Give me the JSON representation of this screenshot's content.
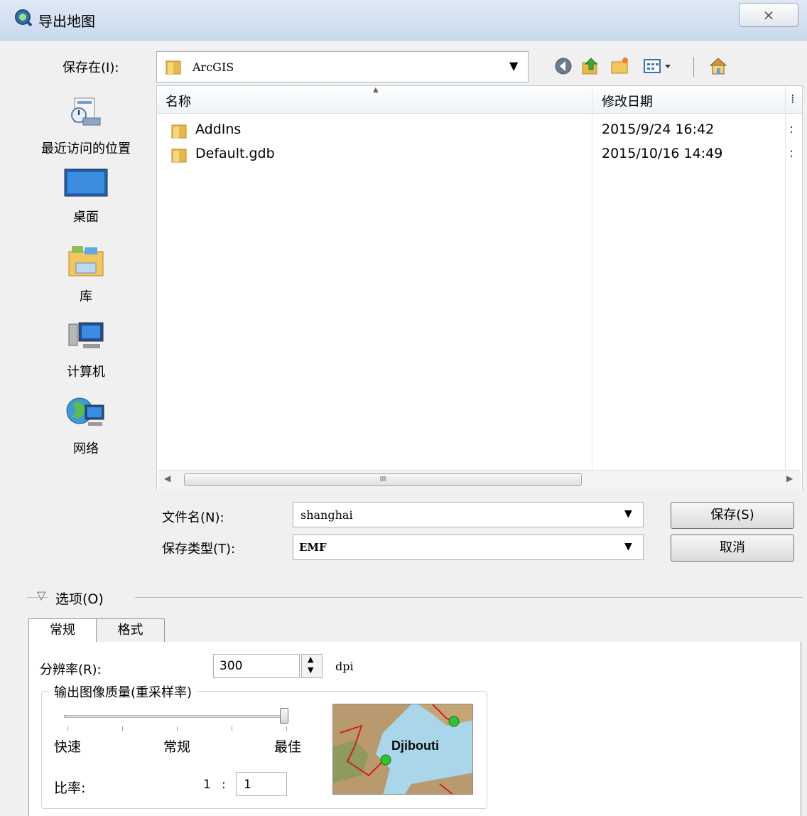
{
  "window": {
    "title": "导出地图",
    "close_label": "⨯"
  },
  "save_in": {
    "label": "保存在(I):",
    "value": "ArcGIS"
  },
  "toolbar": {
    "icons": [
      "back-icon",
      "up-folder-icon",
      "new-folder-icon",
      "view-menu-icon",
      "home-icon"
    ]
  },
  "places": [
    {
      "label": "最近访问的位置",
      "icon": "recent-places-icon"
    },
    {
      "label": "桌面",
      "icon": "desktop-icon"
    },
    {
      "label": "库",
      "icon": "libraries-icon"
    },
    {
      "label": "计算机",
      "icon": "computer-icon"
    },
    {
      "label": "网络",
      "icon": "network-icon"
    }
  ],
  "file_list": {
    "columns": [
      "名称",
      "修改日期"
    ],
    "rows": [
      {
        "name": "AddIns",
        "date": "2015/9/24 16:42"
      },
      {
        "name": "Default.gdb",
        "date": "2015/10/16 14:49"
      }
    ],
    "scroll_grip": "III"
  },
  "filename": {
    "label": "文件名(N):",
    "value": "shanghai"
  },
  "filetype": {
    "label": "保存类型(T):",
    "value": "EMF"
  },
  "buttons": {
    "save": "保存(S)",
    "cancel": "取消"
  },
  "options": {
    "toggle_label": "选项(O)",
    "tabs": [
      "常规",
      "格式"
    ],
    "resolution": {
      "label": "分辨率(R):",
      "value": "300",
      "unit": "dpi"
    },
    "quality": {
      "title": "输出图像质量(重采样率)",
      "marks": [
        "快速",
        "常规",
        "最佳"
      ],
      "slider_value": 1.0,
      "ratio_label": "比率:",
      "ratio_left": "1",
      "ratio_sep": ":",
      "ratio_right": "1"
    },
    "preview_label": "Djibouti"
  },
  "colors": {
    "accent": "#3b73b9",
    "selection": "#cce4f7"
  }
}
